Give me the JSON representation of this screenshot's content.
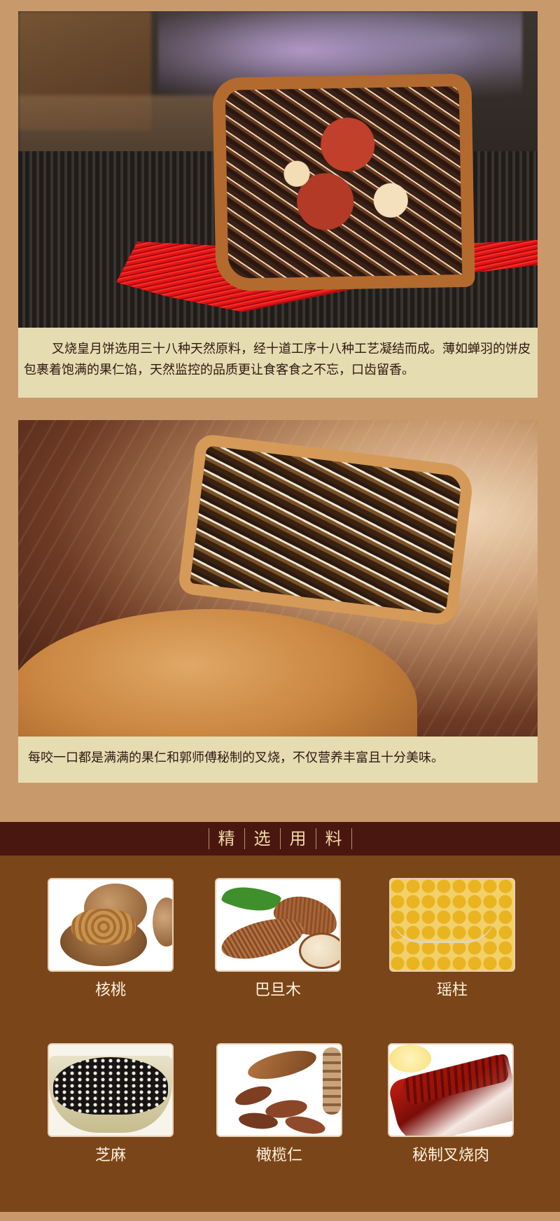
{
  "captions": {
    "first": "叉烧皇月饼选用三十八种天然原料，经十道工序十八种工艺凝结而成。薄如蝉羽的饼皮包裹着饱满的果仁馅，天然监控的品质更让食客食之不忘，口齿留香。",
    "second": "每咬一口都是满满的果仁和郭师傅秘制的叉烧，不仅营养丰富且十分美味。"
  },
  "section_header": {
    "chars": [
      "精",
      "选",
      "用",
      "料"
    ]
  },
  "ingredients": [
    {
      "label": "核桃",
      "icon": "walnut-icon"
    },
    {
      "label": "巴旦木",
      "icon": "almond-icon"
    },
    {
      "label": "瑶柱",
      "icon": "scallop-icon"
    },
    {
      "label": "芝麻",
      "icon": "sesame-icon"
    },
    {
      "label": "橄榄仁",
      "icon": "olive-kernel-icon"
    },
    {
      "label": "秘制叉烧肉",
      "icon": "char-siu-icon"
    }
  ],
  "colors": {
    "page_bg": "#c89a6b",
    "caption_bg": "#e6dcb2",
    "band_bg": "#4a1710",
    "ingredients_bg": "#7a4519",
    "label_text": "#fff3de"
  }
}
